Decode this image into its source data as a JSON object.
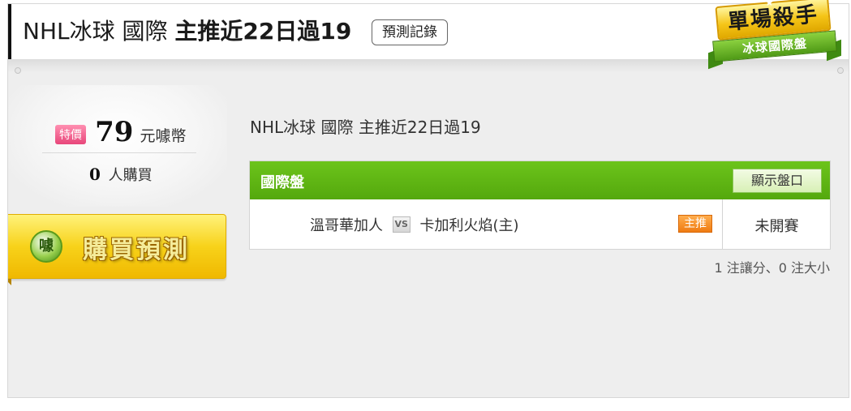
{
  "header": {
    "title_prefix": "NHL冰球 國際",
    "title_bold": "主推近22日過19",
    "record_button": "預測記錄"
  },
  "badge": {
    "main": "單場殺手",
    "ribbon": "冰球國際盤"
  },
  "purchase": {
    "special_tag": "特價",
    "price": "79",
    "price_unit": "元噱幣",
    "buyer_count": "0",
    "buyer_label": "人購買",
    "buy_icon_text": "噱",
    "buy_button": "購買預測"
  },
  "main": {
    "subtitle": "NHL冰球 國際 主推近22日過19",
    "table": {
      "header_label": "國際盤",
      "toggle_button": "顯示盤口",
      "rows": [
        {
          "away": "溫哥華加人",
          "vs": "VS",
          "home": "卡加利火焰(主)",
          "tag": "主推",
          "status": "未開賽"
        }
      ]
    },
    "summary": "1 注讓分、0 注大小"
  },
  "colors": {
    "accent_green": "#5cb315",
    "badge_gold": "#f5c518",
    "tag_orange": "#ef7b12",
    "tag_pink": "#e8467a"
  }
}
